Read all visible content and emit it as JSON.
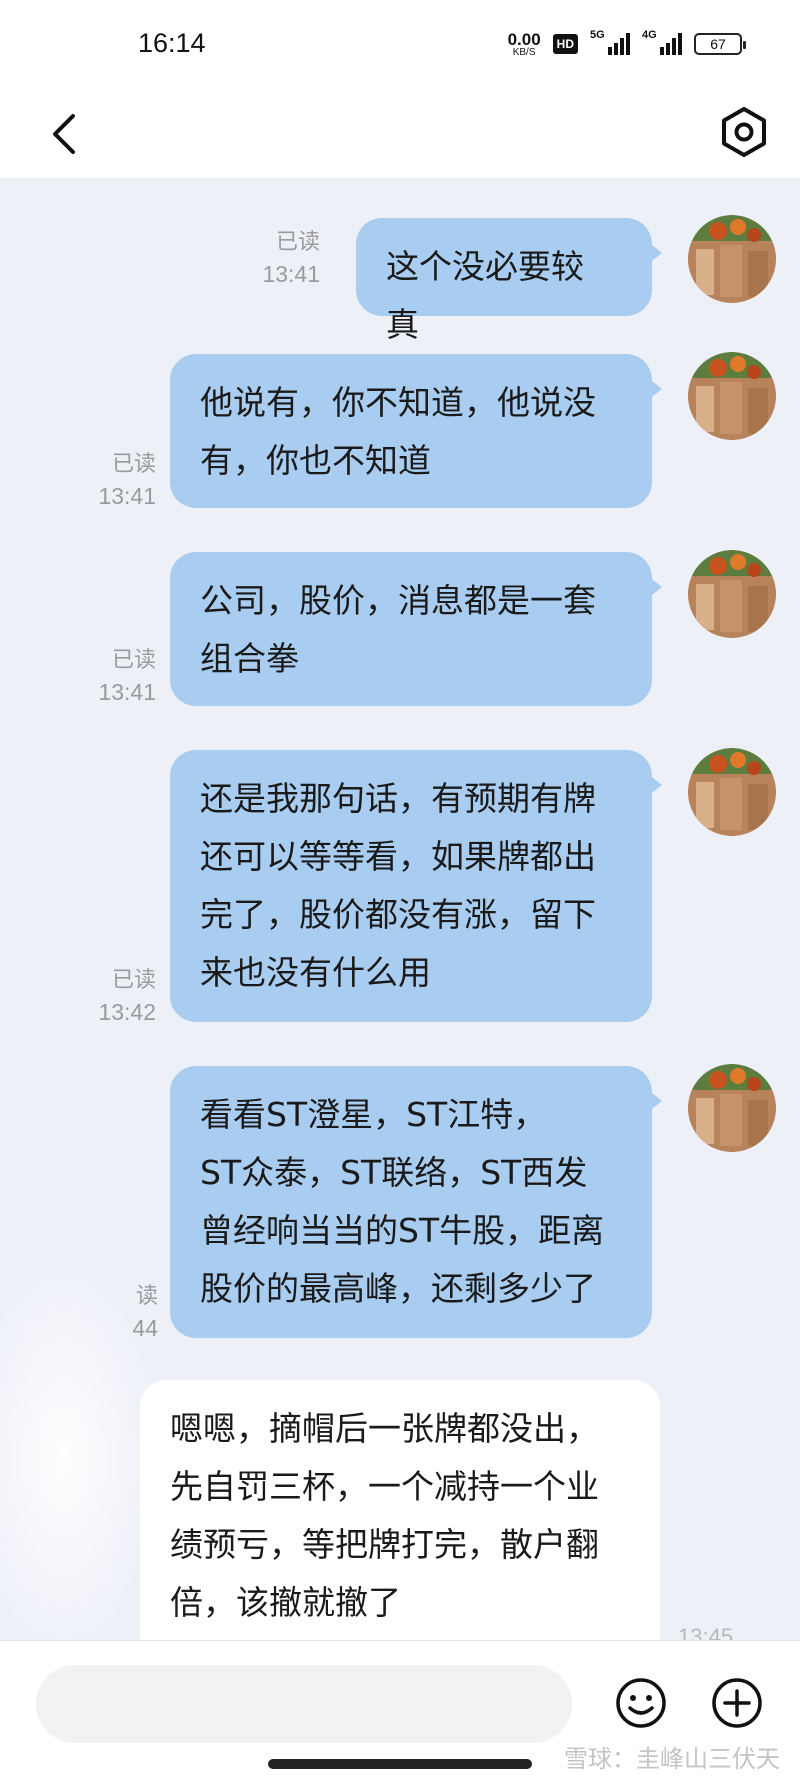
{
  "status_bar": {
    "time": "16:14",
    "net_speed_value": "0.00",
    "net_speed_unit": "KB/S",
    "hd_label": "HD",
    "signal1_label": "5G",
    "signal2_label": "4G",
    "battery": "67"
  },
  "nav": {
    "back_icon": "chevron-left-icon",
    "settings_icon": "hexagon-gear-icon"
  },
  "messages": [
    {
      "lines": [
        "这个没必要较真"
      ],
      "read_label": "已读",
      "time": "13:41"
    },
    {
      "lines": [
        "他说有，你不知道，他说没",
        "有，你也不知道"
      ],
      "read_label": "已读",
      "time": "13:41"
    },
    {
      "lines": [
        "公司，股价，消息都是一套",
        "组合拳"
      ],
      "read_label": "已读",
      "time": "13:41"
    },
    {
      "lines": [
        "还是我那句话，有预期有牌",
        "还可以等等看，如果牌都出",
        "完了，股价都没有涨，留下",
        "来也没有什么用"
      ],
      "read_label": "已读",
      "time": "13:42"
    },
    {
      "lines": [
        "看看ST澄星，ST江特，",
        "ST众泰，ST联络，ST西发",
        "曾经响当当的ST牛股，距离",
        "股价的最高峰，还剩多少了"
      ],
      "read_label": "读",
      "time": "44"
    }
  ],
  "incoming": {
    "lines": [
      "嗯嗯，摘帽后一张牌都没出，",
      "先自罚三杯，一个减持一个业",
      "绩预亏，等把牌打完，散户翻",
      "倍，该撤就撤了"
    ],
    "time": "13:45"
  },
  "input": {
    "value": "",
    "emoji_icon": "smiley-icon",
    "add_icon": "plus-circle-icon"
  },
  "watermark": {
    "text": "雪球：圭峰山三伏天"
  },
  "colors": {
    "bubble_out": "#a9cdf0",
    "bubble_in": "#ffffff",
    "chat_bg": "#eef0f8",
    "meta_text": "#9a9a9a"
  }
}
